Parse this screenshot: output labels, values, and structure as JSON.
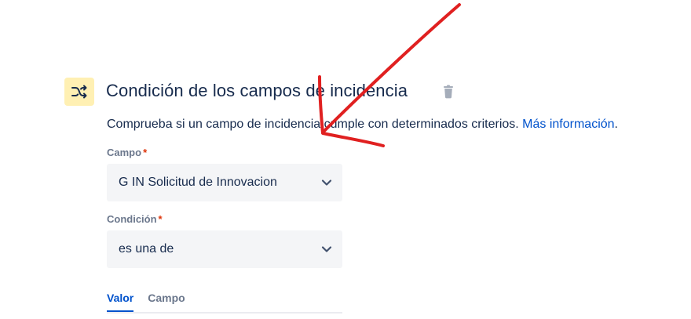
{
  "condition": {
    "title": "Condición de los campos de incidencia",
    "description": "Comprueba si un campo de incidencia cumple con determinados criterios.",
    "more_info_link": "Más información",
    "period": "."
  },
  "form": {
    "field_label": "Campo",
    "field_value": "G IN Solicitud de Innovacion",
    "condition_label": "Condición",
    "condition_value": "es una de",
    "required_marker": "*"
  },
  "tabs": [
    {
      "label": "Valor",
      "active": true
    },
    {
      "label": "Campo",
      "active": false
    }
  ],
  "colors": {
    "icon_bg": "#fff0b3",
    "link": "#0052cc",
    "annotation_arrow": "#e02020"
  },
  "icons": {
    "header": "shuffle-icon",
    "delete": "trash-icon",
    "dropdown": "chevron-down-icon"
  }
}
